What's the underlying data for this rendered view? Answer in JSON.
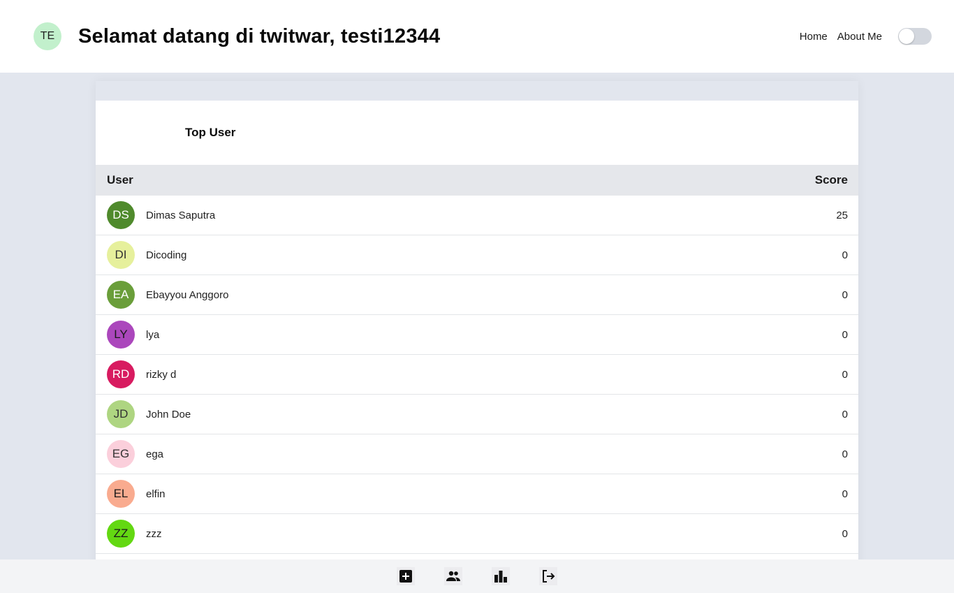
{
  "header": {
    "avatar_initials": "TE",
    "avatar_color": "#c2f0cc",
    "title": "Selamat datang di twitwar, testi12344",
    "nav": {
      "home": "Home",
      "about": "About Me"
    },
    "theme_toggle_on": false
  },
  "leaderboard": {
    "title": "Top User",
    "columns": {
      "user": "User",
      "score": "Score"
    },
    "rows": [
      {
        "initials": "DS",
        "name": "Dimas Saputra",
        "score": "25",
        "avatar_color": "#4f8a2c",
        "text_color": "#ffffff"
      },
      {
        "initials": "DI",
        "name": "Dicoding",
        "score": "0",
        "avatar_color": "#e6f09c",
        "text_color": "#333333"
      },
      {
        "initials": "EA",
        "name": "Ebayyou Anggoro",
        "score": "0",
        "avatar_color": "#6a9e3a",
        "text_color": "#ffffff"
      },
      {
        "initials": "LY",
        "name": "lya",
        "score": "0",
        "avatar_color": "#ab47bc",
        "text_color": "#1a1a1a"
      },
      {
        "initials": "RD",
        "name": "rizky d",
        "score": "0",
        "avatar_color": "#d81b60",
        "text_color": "#ffffff"
      },
      {
        "initials": "JD",
        "name": "John Doe",
        "score": "0",
        "avatar_color": "#aed581",
        "text_color": "#333333"
      },
      {
        "initials": "EG",
        "name": "ega",
        "score": "0",
        "avatar_color": "#fbcfdb",
        "text_color": "#333333"
      },
      {
        "initials": "EL",
        "name": "elfin",
        "score": "0",
        "avatar_color": "#f9ab8f",
        "text_color": "#1a1a1a"
      },
      {
        "initials": "ZZ",
        "name": "zzz",
        "score": "0",
        "avatar_color": "#63d812",
        "text_color": "#1a1a1a"
      }
    ]
  },
  "bottom_nav": {
    "items": [
      "add-thread-icon",
      "users-icon",
      "leaderboard-icon",
      "logout-icon"
    ]
  }
}
